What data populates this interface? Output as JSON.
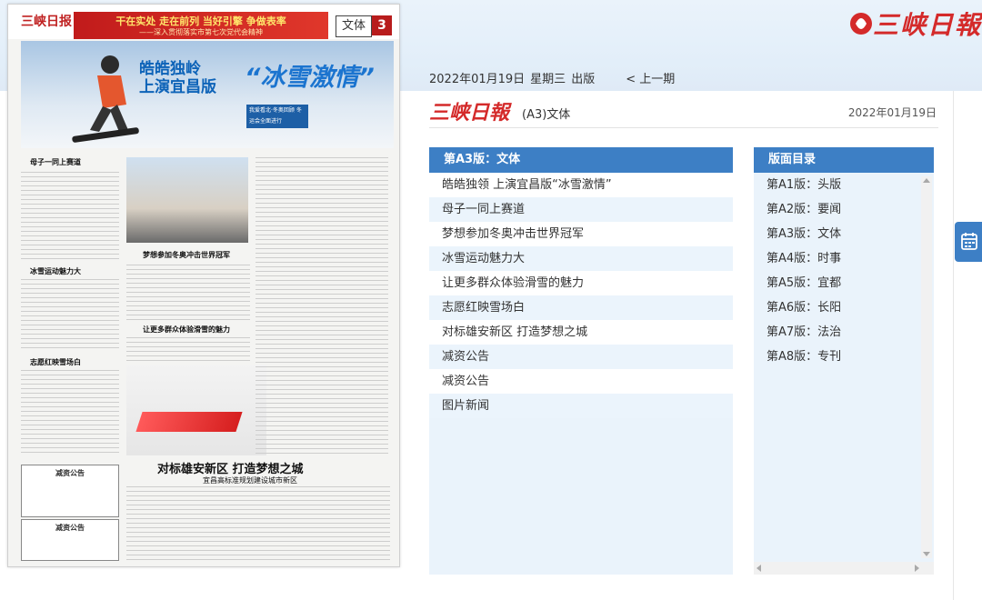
{
  "brand": {
    "name": "三峡日報"
  },
  "datebar": {
    "date": "2022年01月19日",
    "weekday": "星期三",
    "status": "出版",
    "prev": "< 上一期"
  },
  "newspaper": {
    "mini_logo": "三峡日报",
    "banner_main": "干在实处 走在前列 当好引擎 争做表率",
    "banner_sub": "——深入贯彻落实市第七次党代会精神",
    "section": "文体",
    "page_number": "3",
    "hero_line1": "皓皓独岭",
    "hero_line2": "上演宜昌版",
    "hero_big": "“冰雪激情”",
    "hero_box": "我爱看北·冬奥回顾 冬运会全面进行",
    "head_mother": "母子一同上赛道",
    "head_charm": "冰雪运动魅力大",
    "head_volunteer": "志愿红映雪场白",
    "head_dream": "梦想参加冬奥冲击世界冠军",
    "head_people": "让更多群众体验滑雪的魅力",
    "head_xiongan": "对标雄安新区  打造梦想之城",
    "head_xiongan_sub": "宜昌高标准规划建设城市新区",
    "notice1": "减资公告",
    "notice2": "减资公告"
  },
  "page_header": {
    "logo": "三峡日報",
    "label": "(A3)文体",
    "date": "2022年01月19日"
  },
  "articles": {
    "title": "第A3版：文体",
    "items": [
      "皓皓独领 上演宜昌版“冰雪激情”",
      "母子一同上赛道",
      "梦想参加冬奥冲击世界冠军",
      "冰雪运动魅力大",
      "让更多群众体验滑雪的魅力",
      "志愿红映雪场白",
      "对标雄安新区 打造梦想之城",
      "减资公告",
      "减资公告",
      "图片新闻"
    ]
  },
  "pages": {
    "title": "版面目录",
    "items": [
      "第A1版：头版",
      "第A2版：要闻",
      "第A3版：文体",
      "第A4版：时事",
      "第A5版：宜都",
      "第A6版：长阳",
      "第A7版：法治",
      "第A8版：专刊"
    ]
  },
  "colors": {
    "accent": "#3d7fc5",
    "brand_red": "#d42a2a",
    "row_alt": "#ebf4fc"
  },
  "icons": {
    "side_tab": "calendar-icon"
  }
}
